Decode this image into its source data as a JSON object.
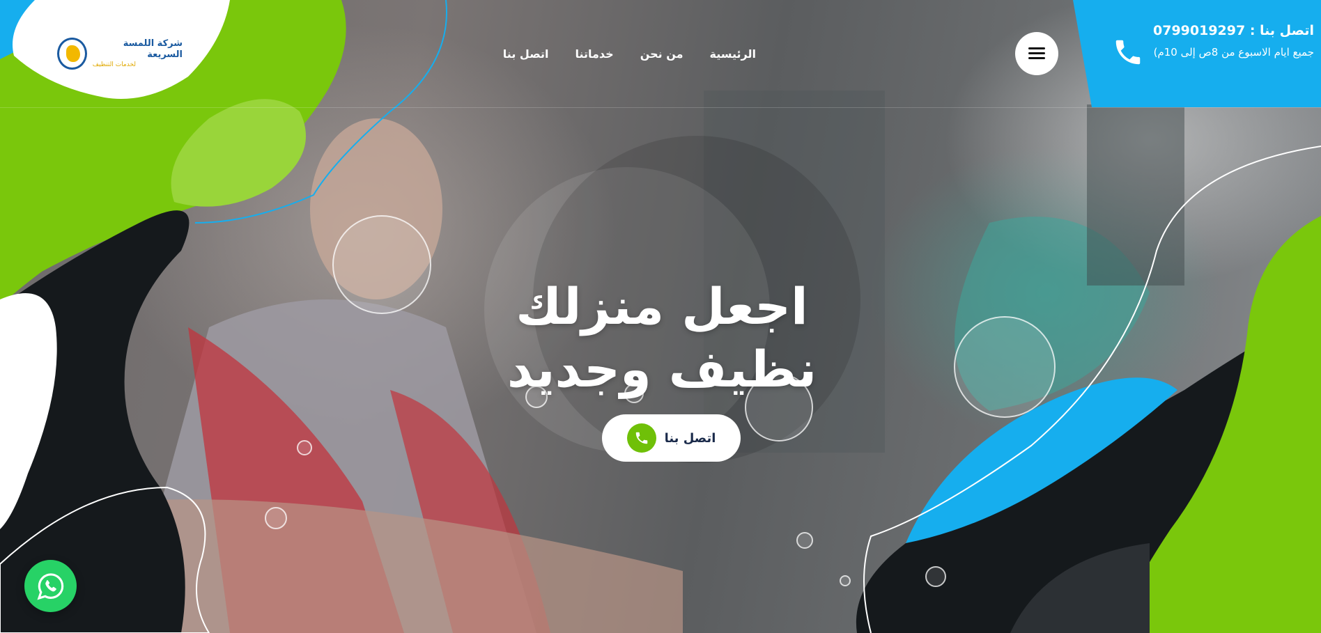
{
  "brand": {
    "name": "شركة اللمسة السريعة",
    "tagline": "لخدمات التنظيف"
  },
  "nav": {
    "items": [
      {
        "label": "الرئيسية"
      },
      {
        "label": "من نحن"
      },
      {
        "label": "خدماتنا"
      },
      {
        "label": "اتصل بنا"
      }
    ]
  },
  "contact": {
    "title": "اتصل بنا : 0799019297",
    "hours": "جميع ايام الاسبوع من 8ص إلى 10م)"
  },
  "hero": {
    "title_line1": "اجعل منزلك",
    "title_line2": "نظيف وجديد",
    "cta_label": "اتصل بنا"
  },
  "icons": {
    "menu": "hamburger-menu-icon",
    "phone": "phone-icon",
    "cta": "phone-icon",
    "whatsapp": "whatsapp-icon"
  },
  "colors": {
    "green": "#7ac70c",
    "blue": "#16aeee",
    "dark": "#15191c",
    "white": "#ffffff",
    "whatsapp": "#27d266"
  }
}
